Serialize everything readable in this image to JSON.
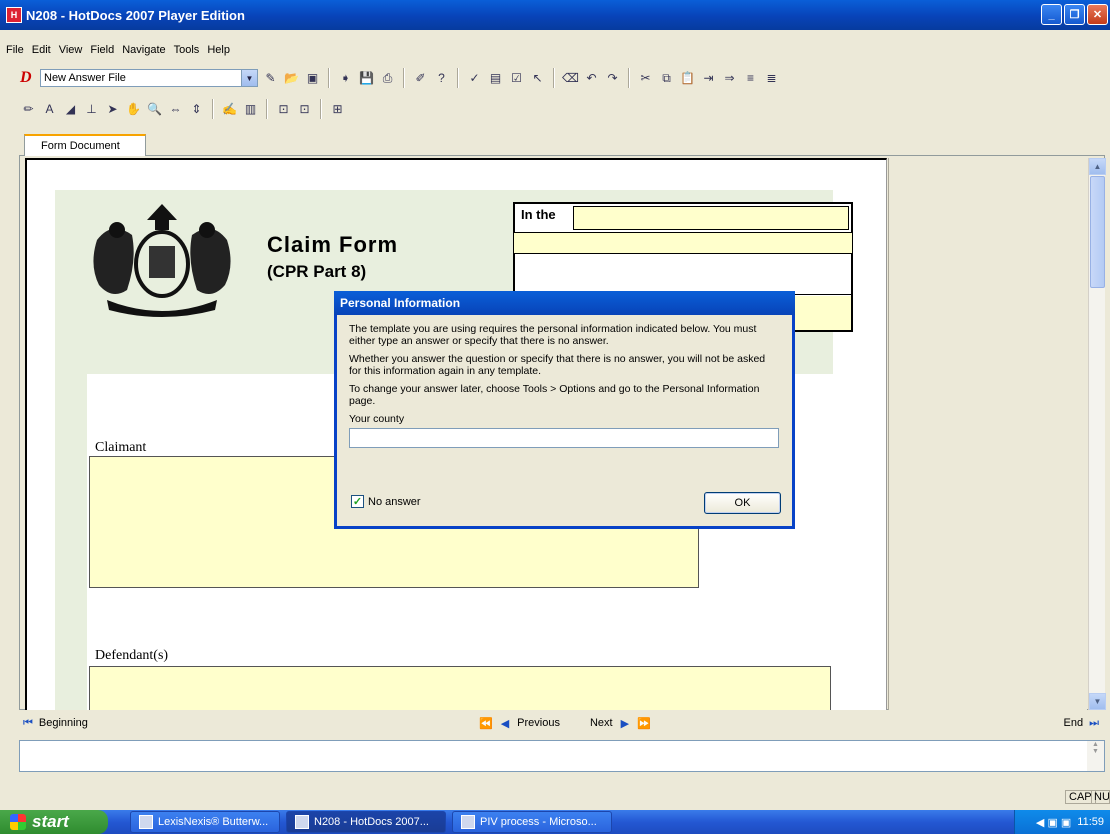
{
  "window": {
    "title": "N208 - HotDocs 2007 Player Edition"
  },
  "menu": [
    "File",
    "Edit",
    "View",
    "Field",
    "Navigate",
    "Tools",
    "Help"
  ],
  "toolbar": {
    "answer_file": "New Answer File"
  },
  "tab": {
    "label": "Form Document"
  },
  "form": {
    "title": "Claim Form",
    "subtitle": "(CPR Part 8)",
    "court_label": "In the",
    "claimant_label": "Claimant",
    "defendant_label": "Defendant(s)"
  },
  "dialog": {
    "title": "Personal Information",
    "para1": "The template you are using requires the personal information indicated below. You must either type an answer or specify that there is no answer.",
    "para2": "Whether you answer the question or specify that there is no answer, you will not be asked for this information again in any template.",
    "para3": "To change your answer later, choose Tools > Options and go to the Personal Information page.",
    "field_label": "Your county",
    "field_value": "",
    "checkbox_label": "No answer",
    "checkbox_checked": true,
    "ok_label": "OK"
  },
  "nav": {
    "beginning": "Beginning",
    "previous": "Previous",
    "next": "Next",
    "end": "End"
  },
  "status": {
    "cap": "CAP",
    "num": "NUM"
  },
  "taskbar": {
    "start": "start",
    "tasks": [
      "LexisNexis® Butterw...",
      "N208 - HotDocs 2007...",
      "PIV process - Microso..."
    ],
    "clock": "11:59"
  }
}
